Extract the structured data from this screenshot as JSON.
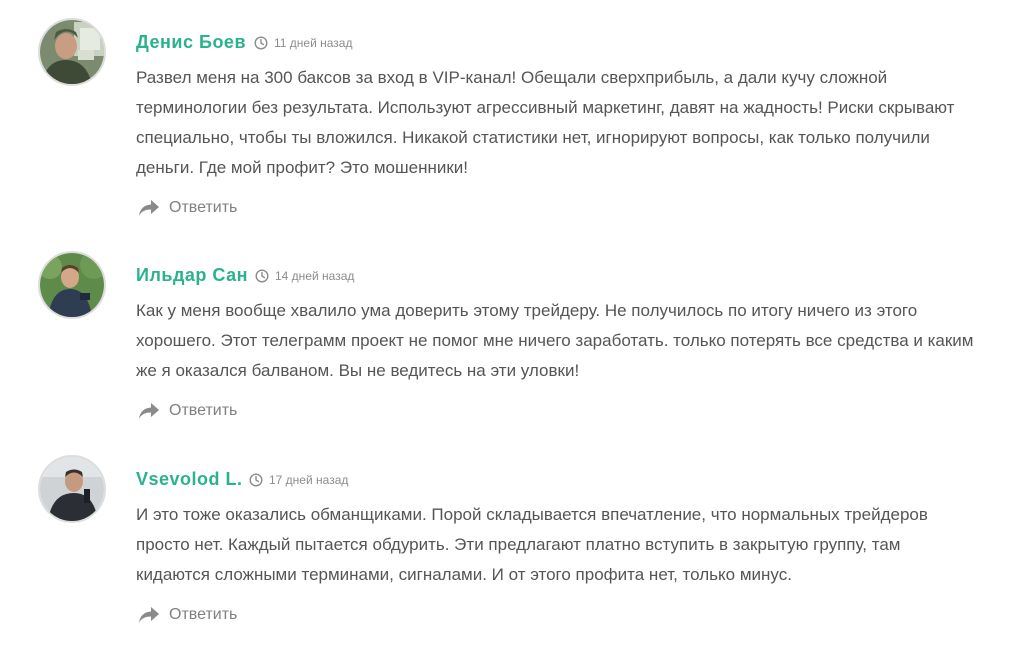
{
  "comments": [
    {
      "author": "Денис Боев",
      "time": "11 дней назад",
      "text": "Развел меня на 300 баксов за вход в VIP-канал! Обещали сверхприбыль, а дали кучу сложной терминологии без результата. Используют агрессивный маркетинг, давят на жадность! Риски скрывают специально, чтобы ты вложился. Никакой статистики нет, игнорируют вопросы, как только получили деньги. Где мой профит? Это мошенники!",
      "reply_label": "Ответить"
    },
    {
      "author": "Ильдар Сан",
      "time": "14 дней назад",
      "text": "Как у меня вообще хвалило ума доверить этому трейдеру. Не получилось по итогу ничего из этого хорошего. Этот телеграмм проект не помог мне ничего заработать. только потерять все средства и каким же я оказался балваном. Вы не ведитесь на эти уловки!",
      "reply_label": "Ответить"
    },
    {
      "author": "Vsevolod L.",
      "time": "17 дней назад",
      "text": "И это тоже оказались обманщиками. Порой складывается впечатление, что нормальных трейдеров просто нет. Каждый пытается обдурить. Эти предлагают платно вступить в закрытую группу, там кидаются сложными терминами, сигналами. И от этого профита нет, только минус.",
      "reply_label": "Ответить"
    }
  ],
  "colors": {
    "author": "#2ab28e",
    "text": "#555555",
    "meta": "#8c8c8c",
    "reply": "#808080"
  },
  "icons": {
    "time": "clock-icon",
    "reply": "reply-arrow-icon"
  }
}
